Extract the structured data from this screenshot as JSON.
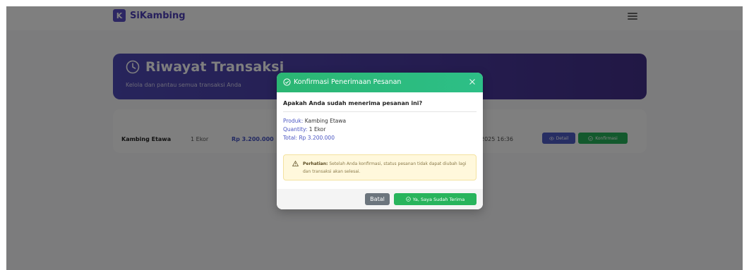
{
  "navbar": {
    "brand_mark": "K",
    "brand_name": "SiKambing"
  },
  "hero": {
    "title": "Riwayat Transaksi",
    "subtitle": "Kelola dan pantau semua transaksi Anda"
  },
  "table": {
    "row": {
      "product": "Kambing Etawa",
      "qty": "1 Ekor",
      "price": "Rp 3.200.000",
      "date": "2025 16:36",
      "detail_label": "Detail",
      "confirm_label": "Konfirmasi"
    }
  },
  "modal": {
    "title": "Konfirmasi Penerimaan Pesanan",
    "question": "Apakah Anda sudah menerima pesanan ini?",
    "product_label": "Produk:",
    "product_value": "Kambing Etawa",
    "quantity_label": "Quantity:",
    "quantity_value": "1 Ekor",
    "total_label": "Total:",
    "total_value": "Rp 3.200.000",
    "warning_label": "Perhatian:",
    "warning_text": "Setelah Anda konfirmasi, status pesanan tidak dapat diubah lagi dan transaksi akan selesai.",
    "cancel_label": "Batal",
    "confirm_label": "Ya, Saya Sudah Terima"
  },
  "colors": {
    "brand": "#4d3fb8",
    "modal_header": "#2bb673",
    "primary_button": "#28b45c",
    "secondary_button": "#6c757d"
  }
}
